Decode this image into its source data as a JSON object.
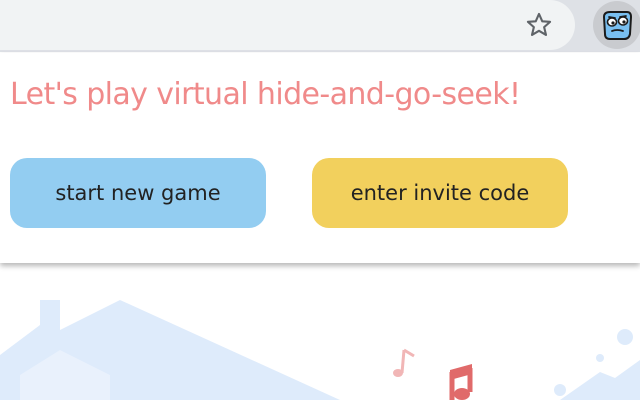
{
  "toolbar": {
    "bookmark_icon": "star-outline-icon",
    "extension_icon": "blue-seeker-face-icon"
  },
  "popup": {
    "title": "Let's play virtual hide-and-go-seek!",
    "start_button_label": "start new game",
    "invite_button_label": "enter invite code"
  },
  "colors": {
    "title": "#f08a8a",
    "start_button": "#93cdf1",
    "invite_button": "#f2d05d",
    "background_house": "#deebfb",
    "music_notes": "#e06a6a"
  }
}
